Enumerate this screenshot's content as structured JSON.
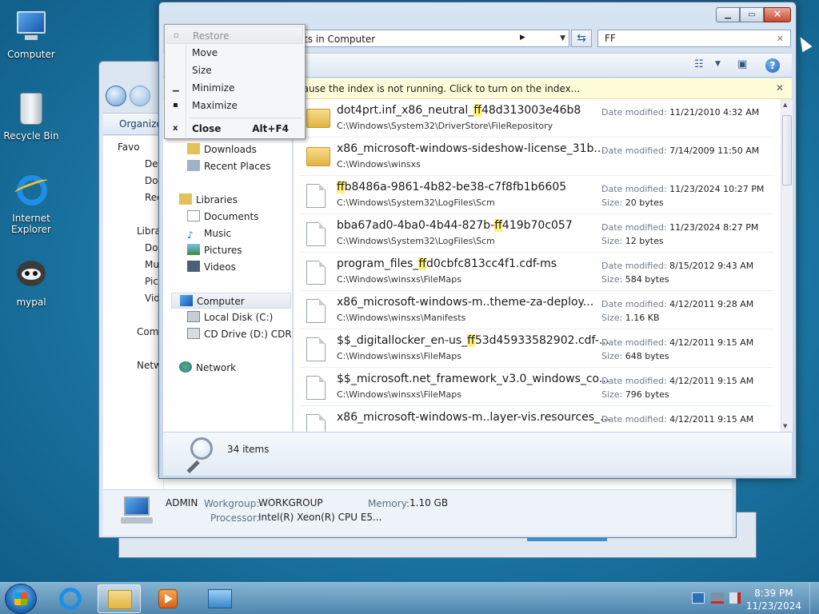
{
  "desktop": {
    "icons": [
      {
        "label": "Computer",
        "icon": "computer-icon"
      },
      {
        "label": "Recycle Bin",
        "icon": "recycle-bin-icon"
      },
      {
        "label": "Internet Explorer",
        "icon": "internet-explorer-icon"
      },
      {
        "label": "mypal",
        "icon": "mypal-icon"
      }
    ]
  },
  "back_window": {
    "toolbar_label": "Organize",
    "tree": [
      "Favo",
      "Des",
      "Dov",
      "Rec",
      "Libra",
      "Doc",
      "Mu",
      "Pic",
      "Vid",
      "Com",
      "Netw"
    ],
    "status": {
      "computer_name": "ADMIN",
      "workgroup_label": "Workgroup:",
      "workgroup": "WORKGROUP",
      "memory_label": "Memory:",
      "memory": "1.10 GB",
      "processor_label": "Processor:",
      "processor": "Intel(R) Xeon(R) CPU E5..."
    }
  },
  "explorer": {
    "address": "ts in Computer",
    "search_value": "FF",
    "infobar": "cause the index is not running.  Click to turn on the index...",
    "nav": {
      "downloads": "Downloads",
      "recent": "Recent Places",
      "libraries": "Libraries",
      "documents": "Documents",
      "music": "Music",
      "pictures": "Pictures",
      "videos": "Videos",
      "computer": "Computer",
      "local_disk": "Local Disk (C:)",
      "cd_drive": "CD Drive (D:) CDROM",
      "network": "Network"
    },
    "date_label": "Date modified:",
    "size_label": "Size:",
    "results": [
      {
        "pre": "dot4prt.inf_x86_neutral_",
        "hl": "ff",
        "post": "48d313003e46b8",
        "path": "C:\\Windows\\System32\\DriverStore\\FileRepository",
        "date": "11/21/2010 4:32 AM",
        "size": "",
        "kind": "folder"
      },
      {
        "pre": "x86_microsoft-windows-sideshow-license_31b...",
        "hl": "",
        "post": "",
        "path": "C:\\Windows\\winsxs",
        "date": "7/14/2009 11:50 AM",
        "size": "",
        "kind": "folder"
      },
      {
        "pre": "",
        "hl": "ff",
        "post": "b8486a-9861-4b82-be38-c7f8fb1b6605",
        "path": "C:\\Windows\\System32\\LogFiles\\Scm",
        "date": "11/23/2024 10:27 PM",
        "size": "20 bytes",
        "kind": "file"
      },
      {
        "pre": "bba67ad0-4ba0-4b44-827b-",
        "hl": "ff",
        "post": "419b70c057",
        "path": "C:\\Windows\\System32\\LogFiles\\Scm",
        "date": "11/23/2024 8:27 PM",
        "size": "12 bytes",
        "kind": "file"
      },
      {
        "pre": "program_files_",
        "hl": "ff",
        "post": "d0cbfc813cc4f1.cdf-ms",
        "path": "C:\\Windows\\winsxs\\FileMaps",
        "date": "8/15/2012 9:43 AM",
        "size": "584 bytes",
        "kind": "file"
      },
      {
        "pre": "x86_microsoft-windows-m..theme-za-deploy...",
        "hl": "",
        "post": "",
        "path": "C:\\Windows\\winsxs\\Manifests",
        "date": "4/12/2011 9:28 AM",
        "size": "1.16 KB",
        "kind": "file"
      },
      {
        "pre": "$$_digitallocker_en-us_",
        "hl": "ff",
        "post": "53d45933582902.cdf-...",
        "path": "C:\\Windows\\winsxs\\FileMaps",
        "date": "4/12/2011 9:15 AM",
        "size": "648 bytes",
        "kind": "file"
      },
      {
        "pre": "$$_microsoft.net_framework_v3.0_windows_co...",
        "hl": "",
        "post": "",
        "path": "C:\\Windows\\winsxs\\FileMaps",
        "date": "4/12/2011 9:15 AM",
        "size": "796 bytes",
        "kind": "file"
      },
      {
        "pre": "x86_microsoft-windows-m..layer-vis.resources_...",
        "hl": "",
        "post": "",
        "path": "",
        "date": "4/12/2011 9:15 AM",
        "size": "",
        "kind": "file"
      }
    ],
    "item_count": "34 items"
  },
  "system_menu": {
    "restore": "Restore",
    "move": "Move",
    "size": "Size",
    "minimize": "Minimize",
    "maximize": "Maximize",
    "close": "Close",
    "close_accel": "Alt+F4"
  },
  "taskbar": {
    "time": "8:39 PM",
    "date": "11/23/2024"
  }
}
